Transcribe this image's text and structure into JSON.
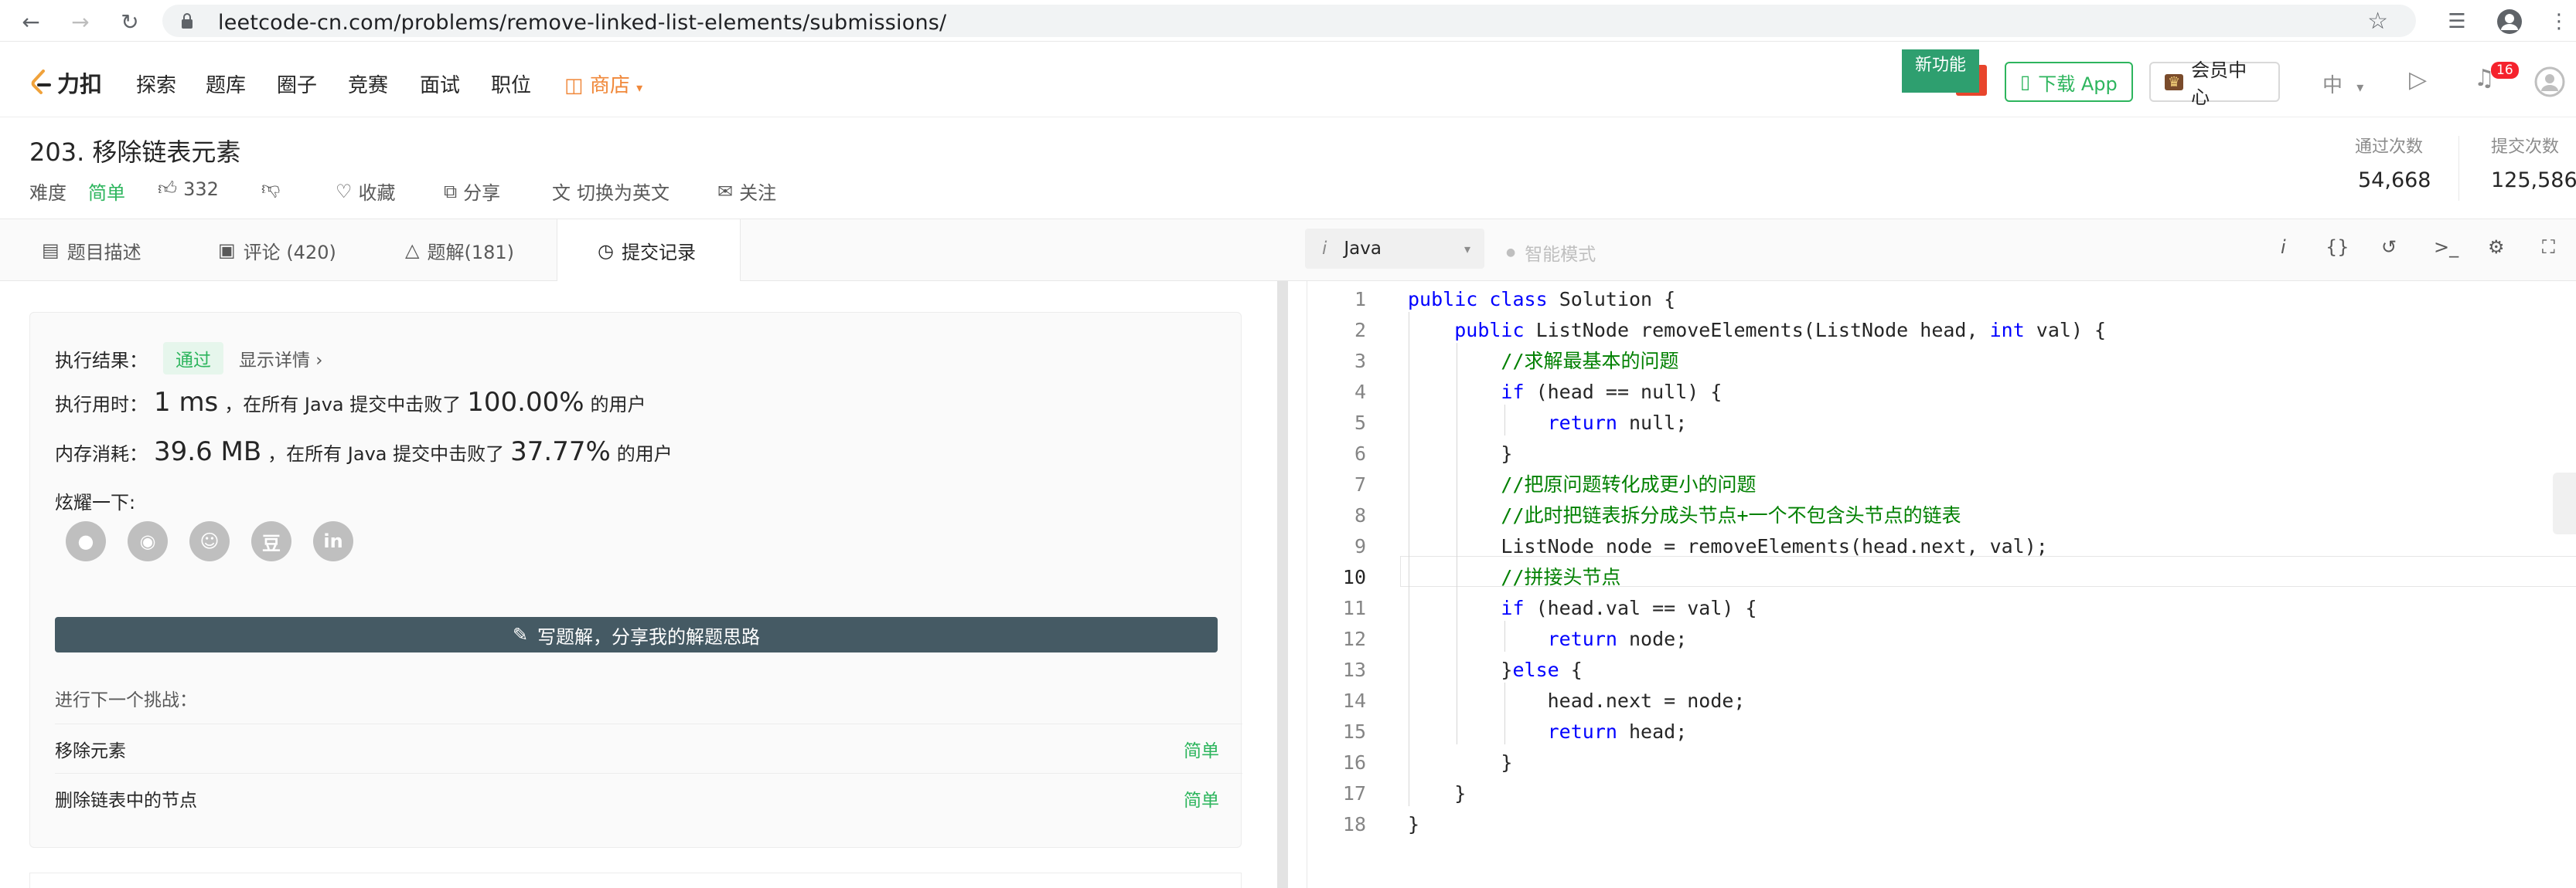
{
  "browser": {
    "url": "leetcode-cn.com/problems/remove-linked-list-elements/submissions/"
  },
  "header": {
    "logo_text": "力扣",
    "nav": [
      "探索",
      "题库",
      "圈子",
      "竞赛",
      "面试",
      "职位"
    ],
    "shop_label": "商店",
    "new_feature_label": "新功能",
    "download_app_label": "下载 App",
    "vip_label": "会员中心",
    "lang_label": "中",
    "notification_count": "16"
  },
  "problem": {
    "title": "203. 移除链表元素",
    "difficulty_label": "难度",
    "difficulty_value": "简单",
    "likes": "332",
    "favorite_label": "收藏",
    "share_label": "分享",
    "switch_lang_label": "切换为英文",
    "follow_label": "关注",
    "pass_count_label": "通过次数",
    "pass_count": "54,668",
    "submit_count_label": "提交次数",
    "submit_count": "125,586"
  },
  "tabs": {
    "description": "题目描述",
    "comments": "评论 (420)",
    "solutions": "题解(181)",
    "submissions": "提交记录"
  },
  "result": {
    "exec_result_label": "执行结果：",
    "status": "通过",
    "show_detail": "显示详情 ›",
    "time_label": "执行用时：",
    "time_value": "1 ms",
    "time_desc": "，在所有 Java 提交中击败了",
    "time_percent": "100.00%",
    "users_suffix": "的用户",
    "memory_label": "内存消耗：",
    "memory_value": "39.6 MB",
    "memory_desc": "，在所有 Java 提交中击败了",
    "memory_percent": "37.77%",
    "share_label": "炫耀一下:",
    "write_solution": "写题解，分享我的解题思路",
    "next_challenge_label": "进行下一个挑战：",
    "challenges": [
      {
        "name": "移除元素",
        "difficulty": "简单"
      },
      {
        "name": "删除链表中的节点",
        "difficulty": "简单"
      }
    ]
  },
  "editor": {
    "language": "Java",
    "smart_mode": "智能模式",
    "lines": [
      "public class Solution {",
      "    public ListNode removeElements(ListNode head, int val) {",
      "        //求解最基本的问题",
      "        if (head == null) {",
      "            return null;",
      "        }",
      "        //把原问题转化成更小的问题",
      "        //此时把链表拆分成头节点+一个不包含头节点的链表",
      "        ListNode node = removeElements(head.next, val);",
      "        //拼接头节点",
      "        if (head.val == val) {",
      "            return node;",
      "        }else {",
      "            head.next = node;",
      "            return head;",
      "        }",
      "    }",
      "}"
    ]
  }
}
